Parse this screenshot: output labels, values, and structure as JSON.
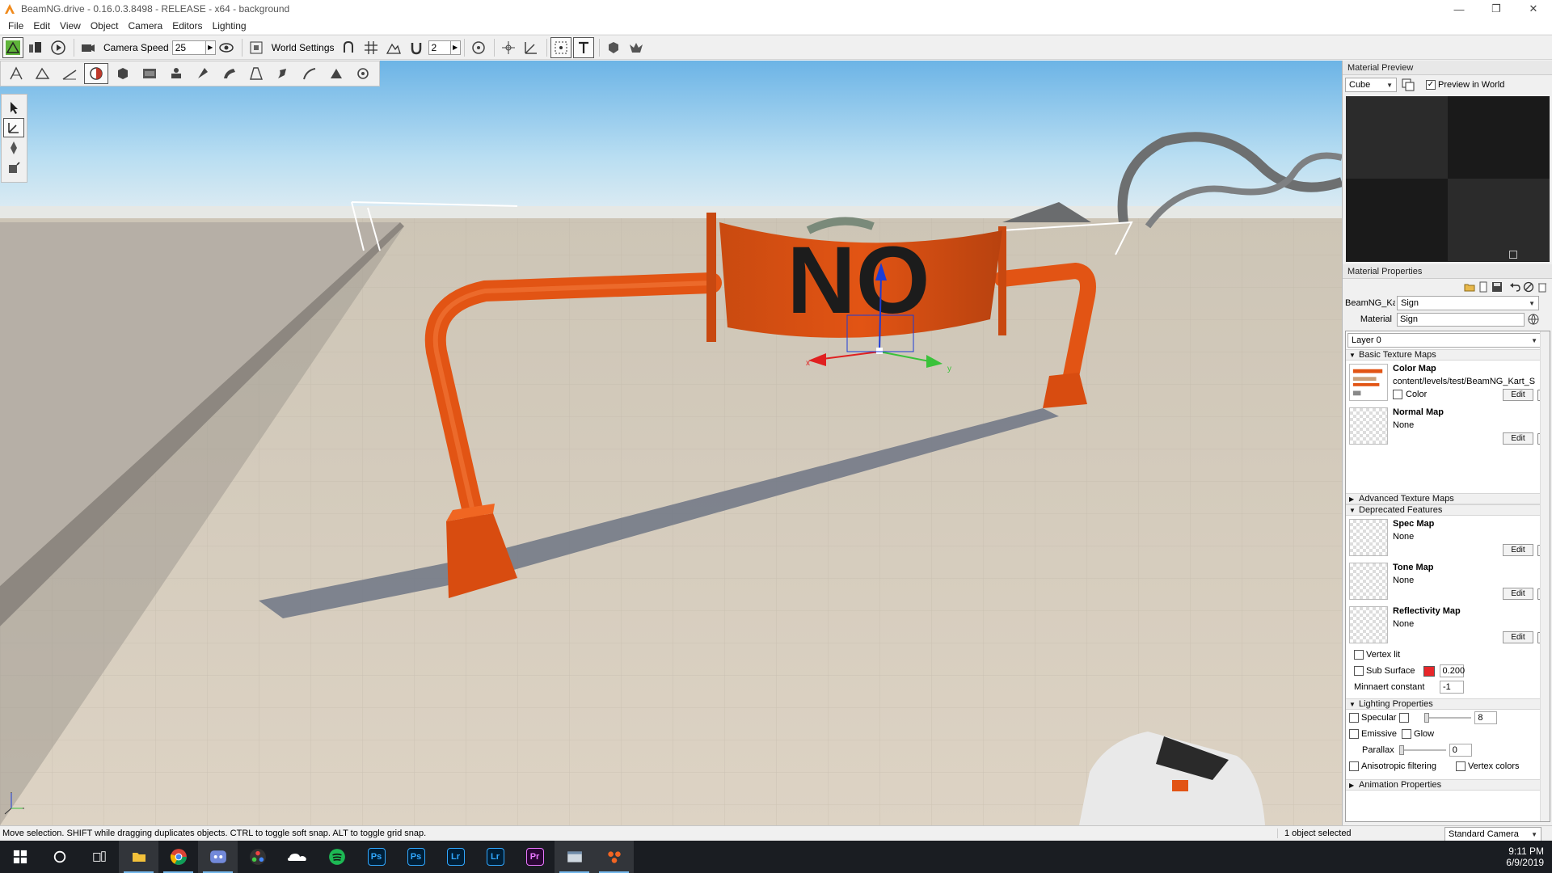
{
  "window": {
    "title": "BeamNG.drive - 0.16.0.3.8498 - RELEASE - x64 - background",
    "controls": [
      "—",
      "❐",
      "✕"
    ]
  },
  "menu": [
    "File",
    "Edit",
    "View",
    "Object",
    "Camera",
    "Editors",
    "Lighting"
  ],
  "toolbar": {
    "camera_speed_label": "Camera Speed",
    "camera_speed_value": "25",
    "world_settings_label": "World Settings",
    "grid_value": "2"
  },
  "viewport": {
    "banner_text": "NO",
    "gizmo_x_label": "x",
    "gizmo_y_label": "y"
  },
  "material_preview": {
    "header": "Material Preview",
    "shape_select": "Cube",
    "preview_in_world_label": "Preview in World",
    "preview_in_world_checked": true
  },
  "material_properties": {
    "header": "Material Properties",
    "object_name": "BeamNG_Kart_",
    "object_select": "Sign",
    "material_label": "Material",
    "material_value": "Sign",
    "layer_select": "Layer 0",
    "sections": {
      "basic": "Basic Texture Maps",
      "advanced": "Advanced Texture Maps",
      "deprecated": "Deprecated Features",
      "lighting": "Lighting Properties",
      "animation": "Animation Properties"
    },
    "color_map": {
      "title": "Color Map",
      "value": "content/levels/test/BeamNG_Kart_S",
      "color_label": "Color",
      "edit": "Edit"
    },
    "normal_map": {
      "title": "Normal Map",
      "value": "None",
      "edit": "Edit"
    },
    "spec_map": {
      "title": "Spec Map",
      "value": "None",
      "edit": "Edit"
    },
    "tone_map": {
      "title": "Tone Map",
      "value": "None",
      "edit": "Edit"
    },
    "reflectivity_map": {
      "title": "Reflectivity Map",
      "value": "None",
      "edit": "Edit"
    },
    "vertex_lit_label": "Vertex lit",
    "sub_surface_label": "Sub Surface",
    "sub_surface_color": "#e8262a",
    "sub_surface_value": "0.200",
    "minnaert_label": "Minnaert constant",
    "minnaert_value": "-1",
    "specular_label": "Specular",
    "specular_value": "8",
    "emissive_label": "Emissive",
    "glow_label": "Glow",
    "parallax_label": "Parallax",
    "parallax_value": "0",
    "anisotropic_label": "Anisotropic filtering",
    "vertex_colors_label": "Vertex colors"
  },
  "status": {
    "message": "Move selection.  SHIFT while dragging duplicates objects.  CTRL to toggle soft snap.  ALT to toggle grid snap.",
    "selection": "1 object selected",
    "camera_mode": "Standard Camera"
  },
  "taskbar": {
    "time": "9:11 PM",
    "date": "6/9/2019",
    "apps": [
      {
        "name": "Ps",
        "color": "#31a8ff",
        "bg": "#001e36"
      },
      {
        "name": "Ps",
        "color": "#31a8ff",
        "bg": "#001e36"
      },
      {
        "name": "Lr",
        "color": "#31a8ff",
        "bg": "#001e36"
      },
      {
        "name": "Lr",
        "color": "#31a8ff",
        "bg": "#001e36"
      },
      {
        "name": "Pr",
        "color": "#ea77ff",
        "bg": "#2a0634"
      }
    ]
  },
  "colors": {
    "accent_orange": "#e25414",
    "sky_top": "#6cb4e6",
    "ground": "#d6cdbf"
  }
}
